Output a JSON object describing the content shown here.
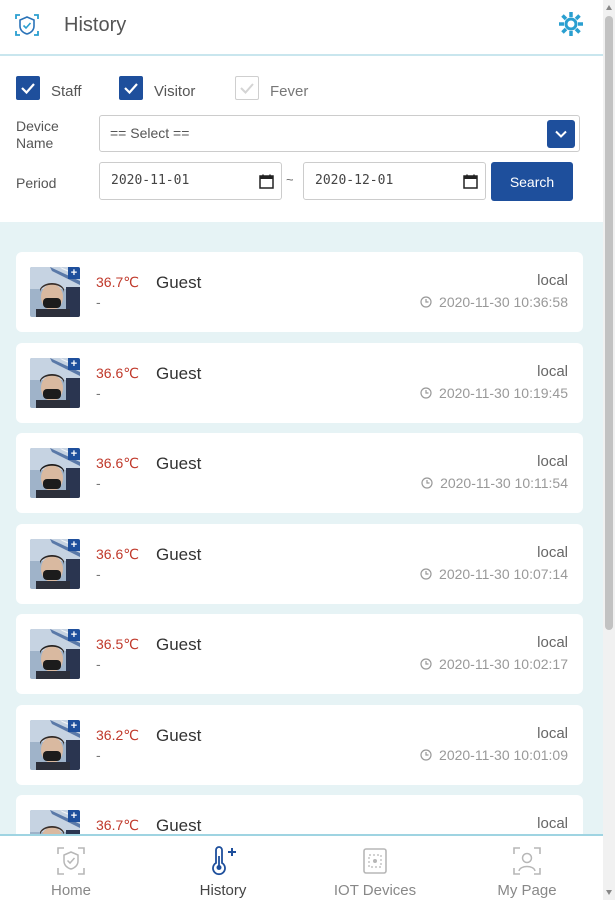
{
  "header": {
    "title": "History",
    "logo_icon": "face-scan-icon",
    "settings_icon": "gear-icon",
    "accent": "#2a9fd0"
  },
  "filters": {
    "checkboxes": [
      {
        "label": "Staff",
        "checked": true
      },
      {
        "label": "Visitor",
        "checked": true
      },
      {
        "label": "Fever",
        "checked": false
      }
    ],
    "device_label_line1": "Device",
    "device_label_line2": "Name",
    "device_select_value": "== Select ==",
    "period_label": "Period",
    "date_from": "2020-11-01",
    "date_separator": "~",
    "date_to": "2020-12-01",
    "search_label": "Search",
    "primary_color": "#1e4f9c"
  },
  "records": [
    {
      "temp": "36.7℃",
      "name": "Guest",
      "detail": "-",
      "source": "local",
      "time": "2020-11-30 10:36:58"
    },
    {
      "temp": "36.6℃",
      "name": "Guest",
      "detail": "-",
      "source": "local",
      "time": "2020-11-30 10:19:45"
    },
    {
      "temp": "36.6℃",
      "name": "Guest",
      "detail": "-",
      "source": "local",
      "time": "2020-11-30 10:11:54"
    },
    {
      "temp": "36.6℃",
      "name": "Guest",
      "detail": "-",
      "source": "local",
      "time": "2020-11-30 10:07:14"
    },
    {
      "temp": "36.5℃",
      "name": "Guest",
      "detail": "-",
      "source": "local",
      "time": "2020-11-30 10:02:17"
    },
    {
      "temp": "36.2℃",
      "name": "Guest",
      "detail": "-",
      "source": "local",
      "time": "2020-11-30 10:01:09"
    },
    {
      "temp": "36.7℃",
      "name": "Guest",
      "detail": "",
      "source": "local",
      "time": ""
    }
  ],
  "nav": {
    "items": [
      {
        "label": "Home",
        "icon": "face-scan-icon",
        "active": false
      },
      {
        "label": "History",
        "icon": "thermometer-plus-icon",
        "active": true
      },
      {
        "label": "IOT Devices",
        "icon": "device-icon",
        "active": false
      },
      {
        "label": "My Page",
        "icon": "user-icon",
        "active": false
      }
    ]
  }
}
